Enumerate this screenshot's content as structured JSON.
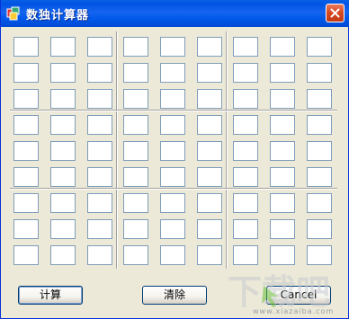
{
  "window": {
    "title": "数独计算器"
  },
  "buttons": {
    "calculate_label": "计算",
    "clear_label": "清除",
    "cancel_label": "Cancel"
  },
  "grid": {
    "rows": 9,
    "cols": 9,
    "values": [
      [
        "",
        "",
        "",
        "",
        "",
        "",
        "",
        "",
        ""
      ],
      [
        "",
        "",
        "",
        "",
        "",
        "",
        "",
        "",
        ""
      ],
      [
        "",
        "",
        "",
        "",
        "",
        "",
        "",
        "",
        ""
      ],
      [
        "",
        "",
        "",
        "",
        "",
        "",
        "",
        "",
        ""
      ],
      [
        "",
        "",
        "",
        "",
        "",
        "",
        "",
        "",
        ""
      ],
      [
        "",
        "",
        "",
        "",
        "",
        "",
        "",
        "",
        ""
      ],
      [
        "",
        "",
        "",
        "",
        "",
        "",
        "",
        "",
        ""
      ],
      [
        "",
        "",
        "",
        "",
        "",
        "",
        "",
        "",
        ""
      ],
      [
        "",
        "",
        "",
        "",
        "",
        "",
        "",
        "",
        ""
      ]
    ]
  },
  "watermark": {
    "url_text": "www.xiazaiba.com"
  },
  "colors": {
    "titlebar": "#0054e3",
    "window_bg": "#ece9d8",
    "cell_border": "#7f9db9",
    "close_button": "#d6471f"
  }
}
